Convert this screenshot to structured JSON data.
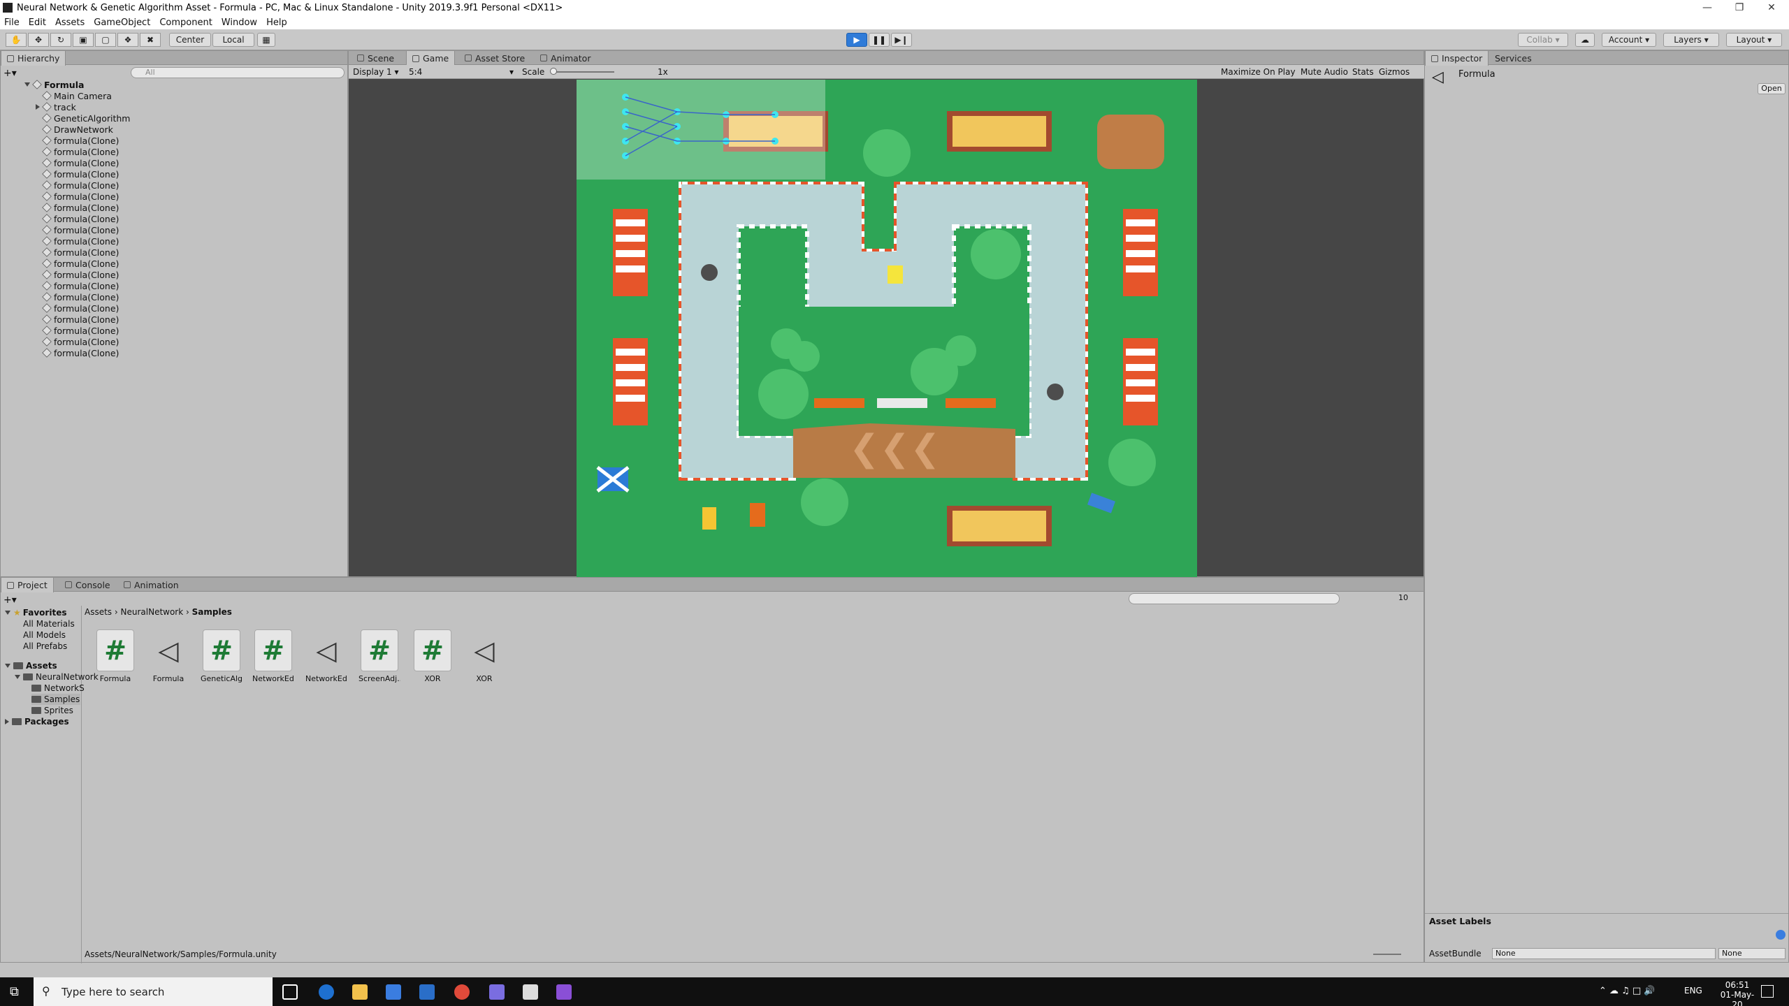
{
  "window": {
    "title": "Neural Network & Genetic Algorithm Asset - Formula - PC, Mac & Linux Standalone - Unity 2019.3.9f1 Personal <DX11>"
  },
  "menu": [
    "File",
    "Edit",
    "Assets",
    "GameObject",
    "Component",
    "Window",
    "Help"
  ],
  "toolbar": {
    "center": "Center",
    "local": "Local",
    "collab": "Collab",
    "account": "Account",
    "layers": "Layers",
    "layout": "Layout"
  },
  "hierarchy": {
    "tab": "Hierarchy",
    "search_placeholder": "All",
    "scene": "Formula",
    "items": [
      "Main Camera",
      "track",
      "GeneticAlgorithm",
      "DrawNetwork",
      "formula(Clone)",
      "formula(Clone)",
      "formula(Clone)",
      "formula(Clone)",
      "formula(Clone)",
      "formula(Clone)",
      "formula(Clone)",
      "formula(Clone)",
      "formula(Clone)",
      "formula(Clone)",
      "formula(Clone)",
      "formula(Clone)",
      "formula(Clone)",
      "formula(Clone)",
      "formula(Clone)",
      "formula(Clone)",
      "formula(Clone)",
      "formula(Clone)",
      "formula(Clone)",
      "formula(Clone)"
    ]
  },
  "game": {
    "tabs": [
      "Scene",
      "Game",
      "Asset Store",
      "Animator"
    ],
    "display": "Display 1",
    "aspect": "5:4",
    "scale_label": "Scale",
    "scale_value": "1x",
    "buttons": [
      "Maximize On Play",
      "Mute Audio",
      "Stats",
      "Gizmos"
    ]
  },
  "inspector": {
    "tabs": [
      "Inspector",
      "Services"
    ],
    "object": "Formula",
    "open": "Open",
    "asset_labels": "Asset Labels",
    "assetbundle_label": "AssetBundle",
    "assetbundle_value": "None",
    "variant_value": "None"
  },
  "project": {
    "tabs": [
      "Project",
      "Console",
      "Animation"
    ],
    "favorites": "Favorites",
    "fav_items": [
      "All Materials",
      "All Models",
      "All Prefabs"
    ],
    "assets_root": "Assets",
    "tree": [
      "NeuralNetwork",
      "NetworkS",
      "Samples",
      "Sprites"
    ],
    "packages": "Packages",
    "breadcrumb": [
      "Assets",
      "NeuralNetwork",
      "Samples"
    ],
    "files": [
      {
        "name": "Formula",
        "kind": "script"
      },
      {
        "name": "Formula",
        "kind": "unity"
      },
      {
        "name": "GeneticAlg...",
        "kind": "script"
      },
      {
        "name": "NetworkEd...",
        "kind": "script"
      },
      {
        "name": "NetworkEd...",
        "kind": "unity"
      },
      {
        "name": "ScreenAdj...",
        "kind": "script"
      },
      {
        "name": "XOR",
        "kind": "script"
      },
      {
        "name": "XOR",
        "kind": "unity"
      }
    ],
    "path": "Assets/NeuralNetwork/Samples/Formula.unity",
    "count": "10"
  },
  "taskbar": {
    "search_placeholder": "Type here to search",
    "lang": "ENG",
    "time": "06:51",
    "date": "01-May-20"
  }
}
